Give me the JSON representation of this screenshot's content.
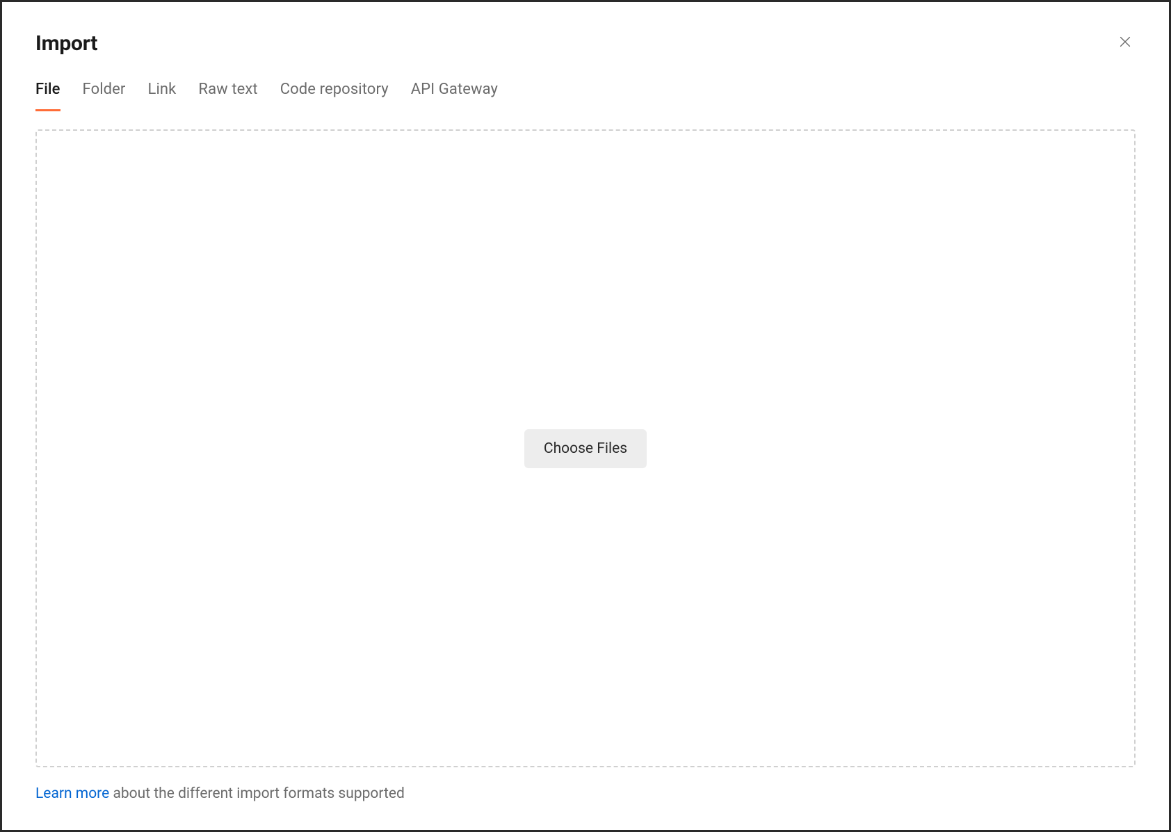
{
  "modal": {
    "title": "Import"
  },
  "tabs": [
    {
      "label": "File",
      "active": true
    },
    {
      "label": "Folder",
      "active": false
    },
    {
      "label": "Link",
      "active": false
    },
    {
      "label": "Raw text",
      "active": false
    },
    {
      "label": "Code repository",
      "active": false
    },
    {
      "label": "API Gateway",
      "active": false
    }
  ],
  "dropzone": {
    "button_label": "Choose Files"
  },
  "footer": {
    "link_text": "Learn more",
    "rest_text": " about the different import formats supported"
  }
}
